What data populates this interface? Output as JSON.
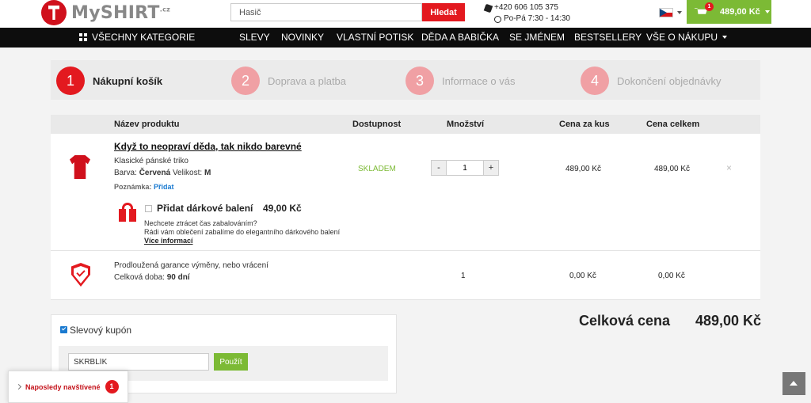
{
  "header": {
    "logo_text": "MySHIRT",
    "logo_suffix": ".cz",
    "search": {
      "value": "Hasič",
      "button_label": "Hledat"
    },
    "contact": {
      "phone": "+420 606 105 375",
      "hours": "Po-Pá 7:30 - 14:30"
    },
    "cart": {
      "count": "1",
      "total": "489,00 Kč"
    }
  },
  "nav": {
    "all_categories": "VŠECHNY KATEGORIE",
    "items": [
      "SLEVY",
      "NOVINKY",
      "VLASTNÍ POTISK",
      "DĚDA A BABIČKA",
      "SE JMÉNEM",
      "BESTSELLERY",
      "VŠE O NÁKUPU"
    ]
  },
  "steps": [
    {
      "number": "1",
      "label": "Nákupní košík"
    },
    {
      "number": "2",
      "label": "Doprava a platba"
    },
    {
      "number": "3",
      "label": "Informace o vás"
    },
    {
      "number": "4",
      "label": "Dokončení objednávky"
    }
  ],
  "table": {
    "headers": {
      "product": "Název produktu",
      "availability": "Dostupnost",
      "quantity": "Množství",
      "unit_price": "Cena za kus",
      "total_price": "Cena celkem"
    },
    "product": {
      "name": "Když to neopraví děda, tak nikdo barevné",
      "subtitle": "Klasické pánské triko",
      "color_label": "Barva:",
      "color_value": "Červená",
      "size_label": "Velikost:",
      "size_value": "M",
      "note_label": "Poznámka:",
      "note_link": "Přidat",
      "availability": "SKLADEM",
      "qty_minus": "-",
      "qty_plus": "+",
      "qty": "1",
      "unit_price": "489,00 Kč",
      "total_price": "489,00 Kč",
      "remove": "×"
    },
    "gift": {
      "label": "Přidat dárkové balení",
      "price": "49,00 Kč",
      "desc1": "Nechcete ztrácet čas zabalováním?",
      "desc2": "Rádi vám oblečení zabalíme do elegantního dárkového balení",
      "more": "Více informací"
    },
    "warranty": {
      "title": "Prodloužená garance výměny, nebo vrácení",
      "duration_label": "Celková doba:",
      "duration_value": "90 dní",
      "qty": "1",
      "unit_price": "0,00 Kč",
      "total_price": "0,00 Kč"
    }
  },
  "coupon": {
    "label": "Slevový kupón",
    "value": "SKRBLÍK",
    "apply_label": "Použít"
  },
  "total": {
    "label": "Celková cena",
    "value": "489,00 Kč"
  },
  "recent": {
    "label": "Naposledy navštívené",
    "count": "1"
  },
  "colors": {
    "brand_red": "#e3191f",
    "green": "#7cba35",
    "dark_nav": "#0d0d0d",
    "link_blue": "#1a7ad0"
  }
}
